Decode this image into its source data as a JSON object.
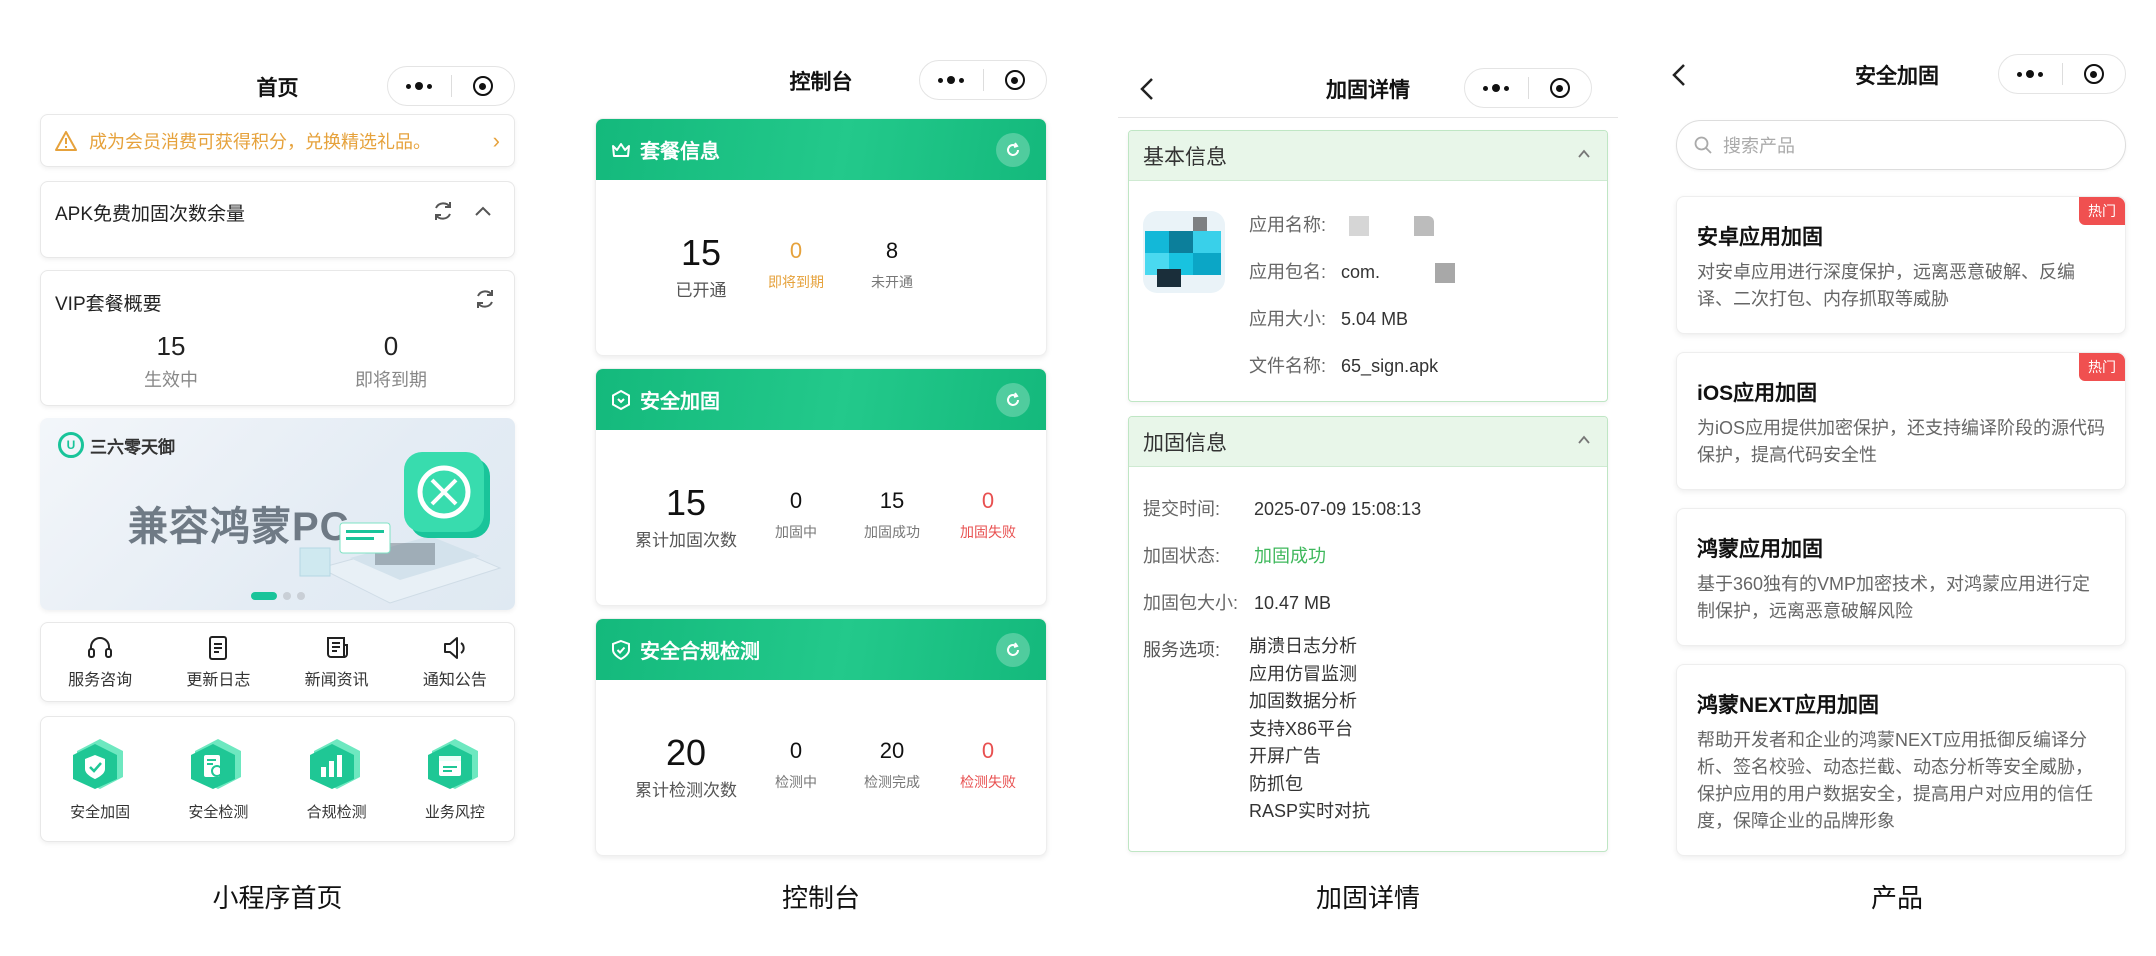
{
  "captions": [
    "小程序首页",
    "控制台",
    "加固详情",
    "产品"
  ],
  "home": {
    "title": "首页",
    "notice": "成为会员消费可获得积分，兑换精选礼品。",
    "apk_title": "APK免费加固次数余量",
    "vip_title": "VIP套餐概要",
    "vip_stats": [
      {
        "value": "15",
        "label": "生效中"
      },
      {
        "value": "0",
        "label": "即将到期"
      }
    ],
    "banner": {
      "logo": "三六零天御",
      "headline": "兼容鸿蒙PC"
    },
    "quick": [
      {
        "label": "服务咨询",
        "icon": "headset-icon"
      },
      {
        "label": "更新日志",
        "icon": "document-icon"
      },
      {
        "label": "新闻资讯",
        "icon": "news-icon"
      },
      {
        "label": "通知公告",
        "icon": "speaker-icon"
      }
    ],
    "services": [
      {
        "label": "安全加固",
        "icon": "shield-check-icon"
      },
      {
        "label": "安全检测",
        "icon": "doc-scan-icon"
      },
      {
        "label": "合规检测",
        "icon": "bar-chart-icon"
      },
      {
        "label": "业务风控",
        "icon": "calendar-icon"
      }
    ]
  },
  "console": {
    "title": "控制台",
    "plan": {
      "title": "套餐信息",
      "main": {
        "value": "15",
        "label": "已开通"
      },
      "items": [
        {
          "value": "0",
          "label": "即将到期",
          "tone": "orange"
        },
        {
          "value": "8",
          "label": "未开通",
          "tone": "normal"
        }
      ]
    },
    "harden": {
      "title": "安全加固",
      "main": {
        "value": "15",
        "label": "累计加固次数"
      },
      "items": [
        {
          "value": "0",
          "label": "加固中",
          "tone": "normal"
        },
        {
          "value": "15",
          "label": "加固成功",
          "tone": "normal"
        },
        {
          "value": "0",
          "label": "加固失败",
          "tone": "red"
        }
      ]
    },
    "compliance": {
      "title": "安全合规检测",
      "main": {
        "value": "20",
        "label": "累计检测次数"
      },
      "items": [
        {
          "value": "0",
          "label": "检测中",
          "tone": "normal"
        },
        {
          "value": "20",
          "label": "检测完成",
          "tone": "normal"
        },
        {
          "value": "0",
          "label": "检测失败",
          "tone": "red"
        }
      ]
    }
  },
  "detail": {
    "title": "加固详情",
    "basic_title": "基本信息",
    "basic": [
      {
        "key": "应用名称:",
        "value": ""
      },
      {
        "key": "应用包名:",
        "value": "com."
      },
      {
        "key": "应用大小:",
        "value": "5.04 MB"
      },
      {
        "key": "文件名称:",
        "value": "65_sign.apk"
      }
    ],
    "harden_title": "加固信息",
    "submit": {
      "key": "提交时间:",
      "value": "2025-07-09 15:08:13"
    },
    "status": {
      "key": "加固状态:",
      "value": "加固成功"
    },
    "size": {
      "key": "加固包大小:",
      "value": "10.47 MB"
    },
    "options_key": "服务选项:",
    "options": [
      "崩溃日志分析",
      "应用仿冒监测",
      "加固数据分析",
      "支持X86平台",
      "开屏广告",
      "防抓包",
      "RASP实时对抗"
    ]
  },
  "products": {
    "title": "安全加固",
    "search_placeholder": "搜索产品",
    "items": [
      {
        "title": "安卓应用加固",
        "desc": "对安卓应用进行深度保护，远离恶意破解、反编译、二次打包、内存抓取等威胁",
        "badge": "热门"
      },
      {
        "title": "iOS应用加固",
        "desc": "为iOS应用提供加密保护，还支持编译阶段的源代码保护，提高代码安全性",
        "badge": "热门"
      },
      {
        "title": "鸿蒙应用加固",
        "desc": "基于360独有的VMP加密技术，对鸿蒙应用进行定制保护，远离恶意破解风险",
        "badge": ""
      },
      {
        "title": "鸿蒙NEXT应用加固",
        "desc": "帮助开发者和企业的鸿蒙NEXT应用抵御反编译分析、签名校验、动态拦截、动态分析等安全威胁，保护应用的用户数据安全，提高用户对应用的信任度，保障企业的品牌形象",
        "badge": ""
      }
    ]
  },
  "colors": {
    "accent": "#1abc84",
    "warning": "#e6a23c",
    "danger": "#e85050",
    "success": "#3fb85c"
  }
}
